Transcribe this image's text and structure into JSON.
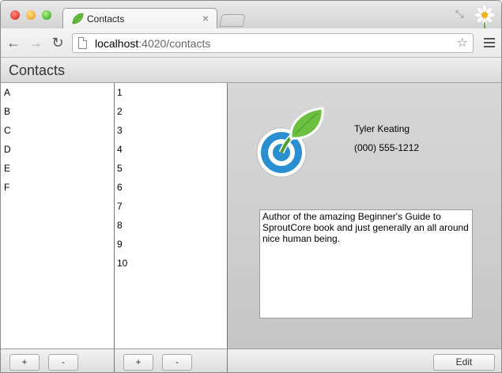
{
  "browser": {
    "tab_title": "Contacts",
    "tab_close": "×",
    "url_host": "localhost",
    "url_rest": ":4020/contacts",
    "back": "←",
    "forward": "→",
    "reload": "↻",
    "star": "☆",
    "fullscreen": "⤡"
  },
  "app": {
    "title": "Contacts"
  },
  "groups": {
    "items": [
      "A",
      "B",
      "C",
      "D",
      "E",
      "F"
    ],
    "add_label": "+",
    "remove_label": "-"
  },
  "contacts": {
    "items": [
      "1",
      "2",
      "3",
      "4",
      "5",
      "6",
      "7",
      "8",
      "9",
      "10"
    ],
    "add_label": "+",
    "remove_label": "-"
  },
  "detail": {
    "name": "Tyler Keating",
    "phone": "(000) 555-1212",
    "bio": "Author of the amazing Beginner's Guide to SproutCore book and just generally an all around nice human being.",
    "edit_label": "Edit"
  },
  "colors": {
    "logo_blue": "#2a8fd0",
    "logo_green": "#5fb33a"
  }
}
